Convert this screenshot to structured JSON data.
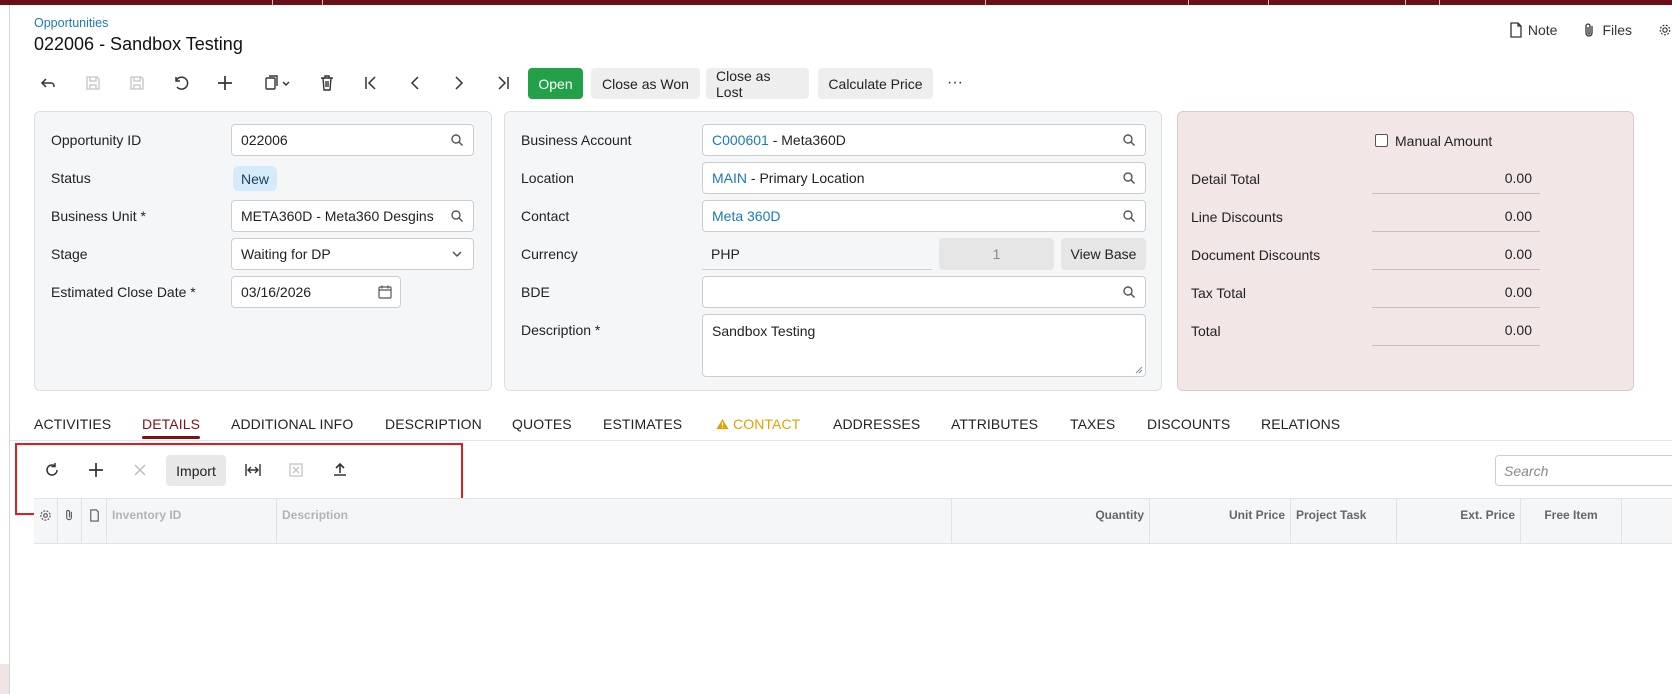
{
  "header": {
    "breadcrumb": "Opportunities",
    "title": "022006 - Sandbox Testing",
    "note_label": "Note",
    "files_label": "Files"
  },
  "toolbar": {
    "open": "Open",
    "close_won": "Close as Won",
    "close_lost": "Close as Lost",
    "calc_price": "Calculate Price",
    "more": "···"
  },
  "left_panel": {
    "opp_id_label": "Opportunity ID",
    "opp_id_value": "022006",
    "status_label": "Status",
    "status_value": "New",
    "bu_label": "Business Unit",
    "bu_value": "META360D - Meta360 Desgins",
    "stage_label": "Stage",
    "stage_value": "Waiting for DP",
    "close_date_label": "Estimated Close Date",
    "close_date_value": "03/16/2026",
    "required_mark": "*"
  },
  "middle_panel": {
    "ba_label": "Business Account",
    "ba_code": "C000601",
    "ba_name": " - Meta360D",
    "loc_label": "Location",
    "loc_code": "MAIN",
    "loc_name": " - Primary Location",
    "contact_label": "Contact",
    "contact_value": "Meta 360D",
    "currency_label": "Currency",
    "currency_value": "PHP",
    "rate_value": "1",
    "view_base": "View Base",
    "bde_label": "BDE",
    "bde_value": "",
    "desc_label": "Description",
    "desc_value": "Sandbox Testing"
  },
  "summary": {
    "manual_amount": "Manual Amount",
    "rows": [
      {
        "label": "Detail Total",
        "value": "0.00"
      },
      {
        "label": "Line Discounts",
        "value": "0.00"
      },
      {
        "label": "Document Discounts",
        "value": "0.00"
      },
      {
        "label": "Tax Total",
        "value": "0.00"
      },
      {
        "label": "Total",
        "value": "0.00"
      }
    ]
  },
  "tabs": [
    "ACTIVITIES",
    "DETAILS",
    "ADDITIONAL INFO",
    "DESCRIPTION",
    "QUOTES",
    "ESTIMATES",
    "CONTACT",
    "ADDRESSES",
    "ATTRIBUTES",
    "TAXES",
    "DISCOUNTS",
    "RELATIONS"
  ],
  "grid": {
    "import_label": "Import",
    "search_placeholder": "Search",
    "columns": {
      "inventory_id": "Inventory ID",
      "description": "Description",
      "quantity": "Quantity",
      "unit_price": "Unit Price",
      "project_task": "Project Task",
      "ext_price": "Ext. Price",
      "free_item": "Free Item"
    }
  },
  "colors": {
    "brand": "#6b0f17",
    "primary_action": "#23a148",
    "link": "#1a7bb5",
    "warning": "#e0a200",
    "highlight_box": "#e11d1d"
  },
  "icons": [
    "back-icon",
    "save-disabled-icon",
    "save-icon",
    "undo-icon",
    "add-icon",
    "copy-paste-icon",
    "delete-icon",
    "first-icon",
    "prev-icon",
    "next-icon",
    "last-icon",
    "search-icon",
    "chevron-down-icon",
    "calendar-icon",
    "refresh-icon",
    "close-icon",
    "fit-columns-icon",
    "excel-icon",
    "upload-icon",
    "gear-icon",
    "paperclip-icon",
    "note-icon",
    "files-icon",
    "warning-icon"
  ]
}
